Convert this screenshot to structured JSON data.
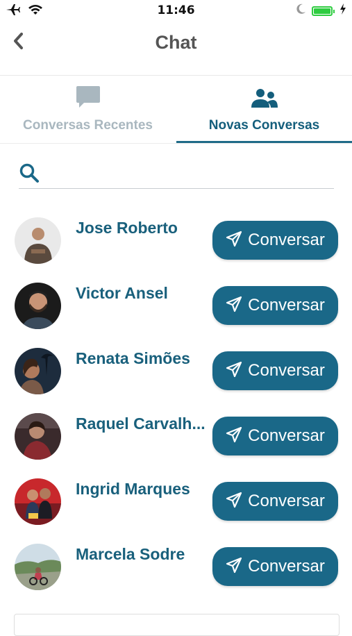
{
  "status_bar": {
    "time": "11:46",
    "icons": [
      "airplane-icon",
      "wifi-icon",
      "moon-icon",
      "battery-icon",
      "charging-icon"
    ],
    "battery_color": "#2ecc40"
  },
  "nav": {
    "title": "Chat",
    "back_icon": "chevron-left-icon"
  },
  "tabs": [
    {
      "label": "Conversas Recentes",
      "icon": "chat-bubble-icon",
      "active": false
    },
    {
      "label": "Novas Conversas",
      "icon": "users-icon",
      "active": true
    }
  ],
  "search": {
    "placeholder": "",
    "value": "",
    "icon": "search-icon"
  },
  "contacts": [
    {
      "name": "Jose Roberto",
      "button_label": "Conversar"
    },
    {
      "name": "Victor Ansel",
      "button_label": "Conversar"
    },
    {
      "name": "Renata Simões",
      "button_label": "Conversar"
    },
    {
      "name": "Raquel Carvalh...",
      "button_label": "Conversar"
    },
    {
      "name": "Ingrid Marques",
      "button_label": "Conversar"
    },
    {
      "name": "Marcela Sodre",
      "button_label": "Conversar"
    }
  ],
  "colors": {
    "accent": "#1a6888",
    "name_text": "#19607c",
    "inactive_tab": "#a9b7bf"
  }
}
